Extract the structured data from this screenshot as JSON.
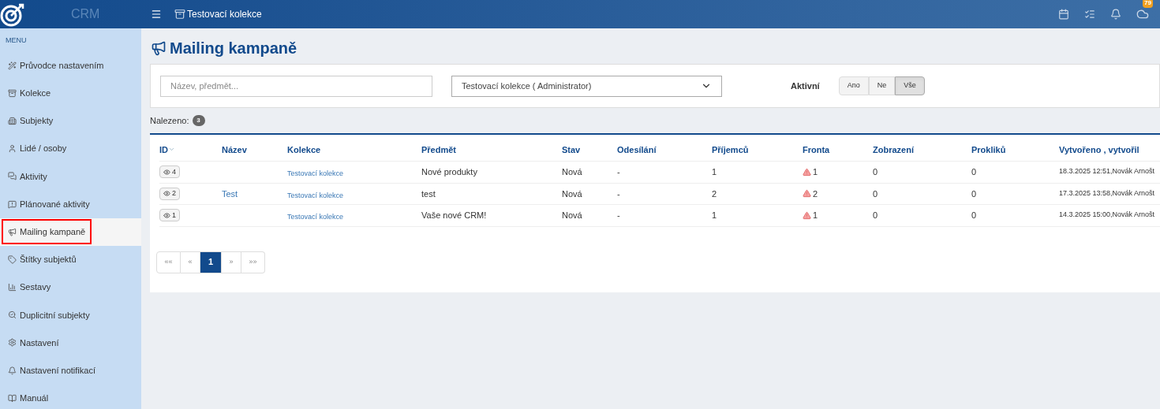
{
  "topbar": {
    "brand": "CRM",
    "collection": "Testovací kolekce",
    "badge": "79"
  },
  "sidebar": {
    "heading": "MENU",
    "items": [
      {
        "label": "Průvodce nastavením",
        "selected": false
      },
      {
        "label": "Kolekce",
        "selected": false
      },
      {
        "label": "Subjekty",
        "selected": false
      },
      {
        "label": "Lidé / osoby",
        "selected": false
      },
      {
        "label": "Aktivity",
        "selected": false
      },
      {
        "label": "Plánované aktivity",
        "selected": false
      },
      {
        "label": "Mailing kampaně",
        "selected": true
      },
      {
        "label": "Štítky subjektů",
        "selected": false
      },
      {
        "label": "Sestavy",
        "selected": false
      },
      {
        "label": "Duplicitní subjekty",
        "selected": false
      },
      {
        "label": "Nastavení",
        "selected": false
      },
      {
        "label": "Nastavení notifikací",
        "selected": false
      },
      {
        "label": "Manuál",
        "selected": false
      }
    ]
  },
  "page": {
    "title": "Mailing kampaně"
  },
  "filters": {
    "search": {
      "placeholder": "Název, předmět..."
    },
    "collection_select": {
      "value": "Testovací kolekce ( Administrator)"
    },
    "active_label": "Aktivní",
    "active_options": [
      {
        "label": "Ano",
        "selected": false
      },
      {
        "label": "Ne",
        "selected": false
      },
      {
        "label": "Vše",
        "selected": true
      }
    ]
  },
  "found": {
    "label": "Nalezeno:",
    "count": "3"
  },
  "table": {
    "columns": [
      "ID",
      "Název",
      "Kolekce",
      "Předmět",
      "Stav",
      "Odesílání",
      "Příjemců",
      "Fronta",
      "Zobrazení",
      "Prokliků",
      "Vytvořeno , vytvořil"
    ],
    "rows": [
      {
        "id": "4",
        "name": "",
        "collection": "Testovací kolekce",
        "subject": "Nové produkty",
        "state": "Nová",
        "sending": "-",
        "recipients": "1",
        "queue": "1",
        "views": "0",
        "clicks": "0",
        "created": "18.3.2025 12:51,Novák Arnošt"
      },
      {
        "id": "2",
        "name": "Test",
        "collection": "Testovací kolekce",
        "subject": "test",
        "state": "Nová",
        "sending": "-",
        "recipients": "2",
        "queue": "2",
        "views": "0",
        "clicks": "0",
        "created": "17.3.2025 13:58,Novák Arnošt"
      },
      {
        "id": "1",
        "name": "",
        "collection": "Testovací kolekce",
        "subject": "Vaše nové CRM!",
        "state": "Nová",
        "sending": "-",
        "recipients": "1",
        "queue": "1",
        "views": "0",
        "clicks": "0",
        "created": "14.3.2025 15:00,Novák Arnošt"
      }
    ]
  },
  "pagination": [
    {
      "label": "««",
      "selected": false
    },
    {
      "label": "«",
      "selected": false
    },
    {
      "label": "1",
      "selected": true
    },
    {
      "label": "»",
      "selected": false
    },
    {
      "label": "»»",
      "selected": false
    }
  ]
}
